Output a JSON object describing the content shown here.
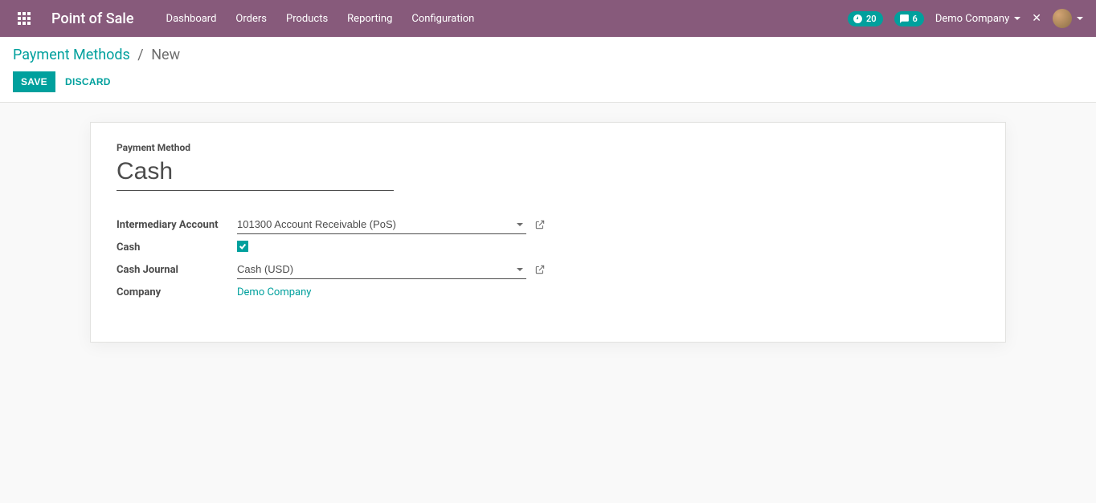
{
  "navbar": {
    "brand": "Point of Sale",
    "menu": [
      "Dashboard",
      "Orders",
      "Products",
      "Reporting",
      "Configuration"
    ],
    "timer_badge": "20",
    "chat_badge": "6",
    "company": "Demo Company"
  },
  "breadcrumb": {
    "parent": "Payment Methods",
    "current": "New"
  },
  "buttons": {
    "save": "Save",
    "discard": "Discard"
  },
  "form": {
    "section_label": "Payment Method",
    "name_value": "Cash",
    "intermediary_label": "Intermediary Account",
    "intermediary_value": "101300 Account Receivable (PoS)",
    "cash_label": "Cash",
    "cash_checked": true,
    "cash_journal_label": "Cash Journal",
    "cash_journal_value": "Cash (USD)",
    "company_label": "Company",
    "company_value": "Demo Company"
  }
}
